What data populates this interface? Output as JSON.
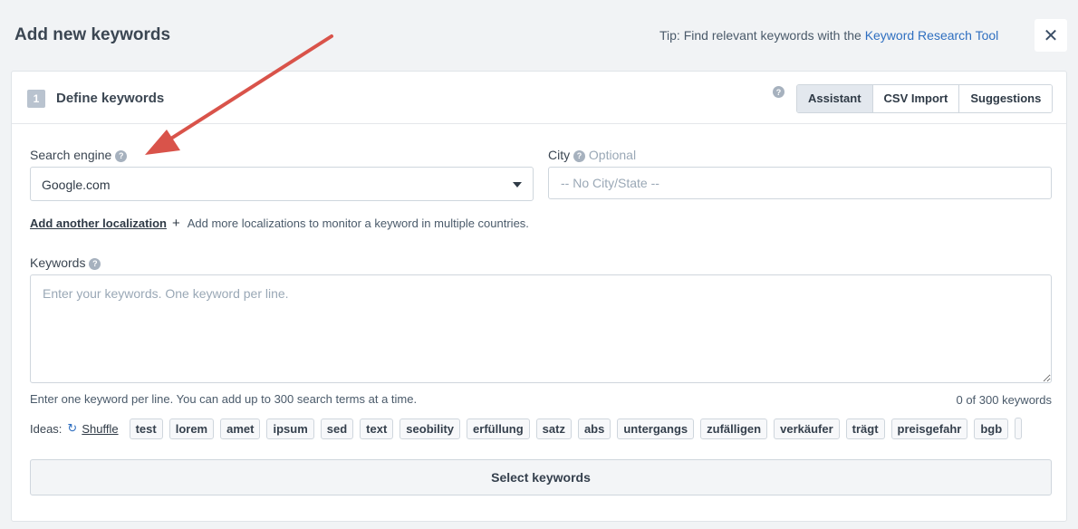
{
  "dialog": {
    "title": "Add new keywords",
    "tip_prefix": "Tip: Find relevant keywords with the ",
    "tip_link": "Keyword Research Tool",
    "close_label": "✕"
  },
  "step": {
    "number": "1",
    "title": "Define keywords",
    "help": "?",
    "tabs": [
      "Assistant",
      "CSV Import",
      "Suggestions"
    ],
    "active_tab": "Assistant"
  },
  "search_engine": {
    "label": "Search engine",
    "value": "Google.com"
  },
  "city": {
    "label": "City",
    "optional": "Optional",
    "placeholder": "-- No City/State --"
  },
  "localization": {
    "link": "Add another localization",
    "plus": "+",
    "hint": "Add more localizations to monitor a keyword in multiple countries."
  },
  "keywords": {
    "label": "Keywords",
    "placeholder": "Enter your keywords. One keyword per line.",
    "hint": "Enter one keyword per line. You can add up to 300 search terms at a time.",
    "count": "0 of 300 keywords"
  },
  "ideas": {
    "label": "Ideas:",
    "shuffle": "Shuffle",
    "chips": [
      "test",
      "lorem",
      "amet",
      "ipsum",
      "sed",
      "text",
      "seobility",
      "erfüllung",
      "satz",
      "abs",
      "untergangs",
      "zufälligen",
      "verkäufer",
      "trägt",
      "preisgefahr",
      "bgb",
      ""
    ]
  },
  "submit": {
    "label": "Select keywords"
  },
  "colors": {
    "annotation_arrow": "#d9534a",
    "link": "#2f6fc0"
  }
}
